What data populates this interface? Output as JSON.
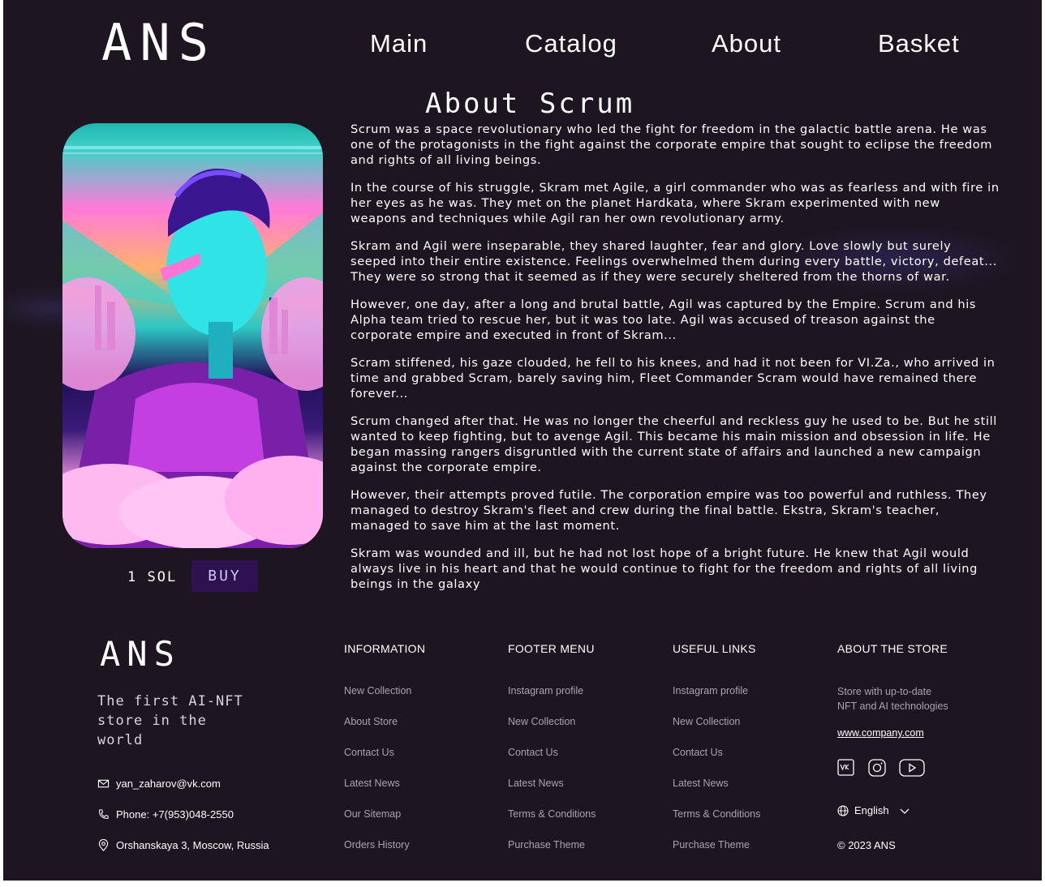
{
  "header": {
    "logo": "ANS",
    "nav": [
      "Main",
      "Catalog",
      "About",
      "Basket"
    ]
  },
  "main": {
    "title": "About Scrum",
    "price": "1 SOL",
    "buy_label": "BUY",
    "paragraphs": [
      "Scrum was a space revolutionary who led the fight for freedom in the galactic battle arena. He was one of the protagonists in the fight against the corporate empire that sought to eclipse the freedom and rights of all living beings.",
      "In the course of his struggle, Skram met Agile, a girl commander who was as fearless and with fire in her eyes as he was. They met on the planet Hardkata, where Skram experimented with new weapons and techniques while Agil ran her own revolutionary army.",
      "Skram and Agil were inseparable, they shared laughter, fear and glory. Love slowly but surely seeped into their entire existence. Feelings overwhelmed them during every battle, victory, defeat... They were so strong that it seemed as if they were securely sheltered from the thorns of war.",
      "However, one day, after a long and brutal battle, Agil was captured by the Empire. Scrum and his Alpha team tried to rescue her, but it was too late. Agil was accused of treason against the corporate empire and executed in front of Skram...",
      "Scram stiffened, his gaze clouded, he fell to his knees, and had it not been for VI.Za., who arrived in time and grabbed Scram, barely saving him, Fleet Commander Scram would have remained there forever...",
      "Scrum changed after that. He was no longer the cheerful and reckless guy he used to be. But he still wanted to keep fighting, but to avenge Agil. This became his main mission and obsession in life. He began massing rangers disgruntled with the current state of affairs and launched a new campaign against the corporate empire.",
      "However, their attempts proved futile. The corporation empire was too powerful and ruthless. They managed to destroy Skram's fleet and crew during the final battle. Ekstra, Skram's teacher, managed to save him at the last moment.",
      "Skram was wounded and ill, but he had not lost hope of a bright future. He knew that Agil would always live in his heart and that he would continue to fight for the freedom and rights of all living beings in the galaxy"
    ]
  },
  "footer": {
    "logo": "ANS",
    "tagline_1": "The first AI-NFT",
    "tagline_2": "store in the world",
    "email": "yan_zaharov@vk.com",
    "phone": "Phone: +7(953)048-2550",
    "address": "Orshanskaya 3, Moscow, Russia",
    "columns": [
      {
        "heading": "INFORMATION",
        "items": [
          "New Collection",
          "About Store",
          "Contact Us",
          "Latest News",
          "Our Sitemap",
          "Orders History"
        ]
      },
      {
        "heading": "FOOTER MENU",
        "items": [
          "Instagram profile",
          "New Collection",
          "Contact Us",
          "Latest News",
          "Terms & Conditions",
          "Purchase Theme"
        ]
      },
      {
        "heading": "USEFUL LINKS",
        "items": [
          "Instagram profile",
          "New Collection",
          "Contact Us",
          "Latest News",
          "Terms & Conditions",
          "Purchase Theme"
        ]
      }
    ],
    "about_heading": "ABOUT THE STORE",
    "about_line_1": "Store with up-to-date",
    "about_line_2": "NFT and AI technologies",
    "website": "www.company.com",
    "social_icons": [
      "vk-icon",
      "instagram-icon",
      "youtube-icon"
    ],
    "language": "English",
    "copyright": "© 2023 ANS"
  },
  "colors": {
    "background": "#1d1520",
    "buy_button": "#2e1150",
    "muted_text": "#a9a3ae"
  }
}
